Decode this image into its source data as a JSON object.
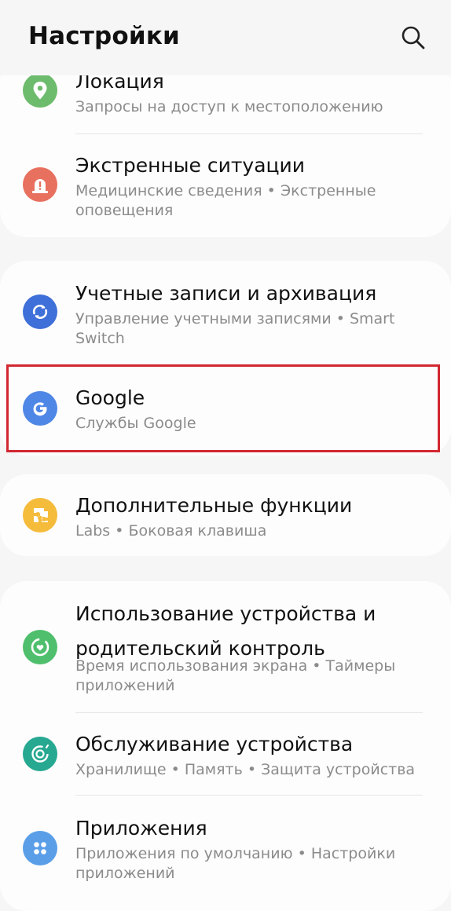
{
  "header": {
    "title": "Настройки",
    "search_icon": "search-icon"
  },
  "groups": [
    {
      "items": [
        {
          "title": "Локация",
          "subtitle": "Запросы на доступ к местоположению",
          "icon": "location-icon",
          "color": "#6dbb6d"
        },
        {
          "title": "Экстренные ситуации",
          "subtitle": "Медицинские сведения  •  Экстренные оповещения",
          "icon": "emergency-icon",
          "color": "#e8705f"
        }
      ]
    },
    {
      "items": [
        {
          "title": "Учетные записи и архивация",
          "subtitle": "Управление учетными записями  •  Smart Switch",
          "icon": "sync-icon",
          "color": "#3f6fd8"
        },
        {
          "title": "Google",
          "subtitle": "Службы Google",
          "icon": "google-icon",
          "color": "#4f87e6"
        }
      ]
    },
    {
      "items": [
        {
          "title": "Дополнительные функции",
          "subtitle": "Labs  •  Боковая клавиша",
          "icon": "puzzle-icon",
          "color": "#f5bb3b"
        }
      ]
    },
    {
      "items": [
        {
          "title": "Использование устройства и родительский контроль",
          "subtitle": "Время использования экрана  •  Таймеры приложений",
          "icon": "wellbeing-icon",
          "color": "#4fbf6d"
        },
        {
          "title": "Обслуживание устройства",
          "subtitle": "Хранилище  •  Память  •  Защита устройства",
          "icon": "device-care-icon",
          "color": "#26a891"
        },
        {
          "title": "Приложения",
          "subtitle": "Приложения по умолчанию  •  Настройки приложений",
          "icon": "apps-icon",
          "color": "#5a9ee8"
        }
      ]
    }
  ],
  "highlight_color": "#d12831"
}
